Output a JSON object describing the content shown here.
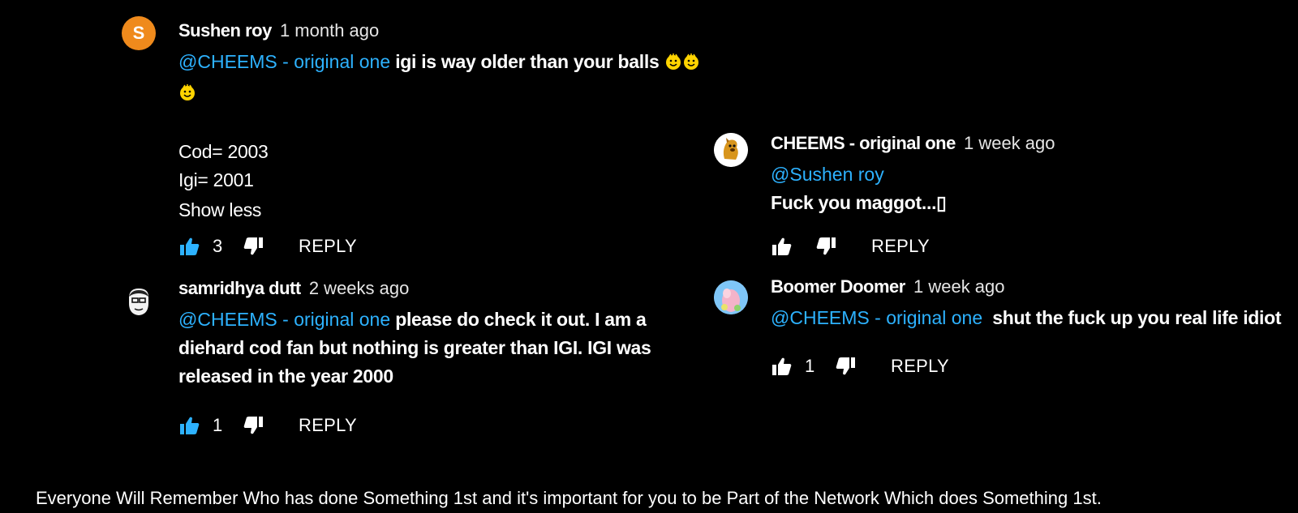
{
  "colors": {
    "mention": "#2db2ff",
    "liked": "#2db2ff",
    "avatar_s": "#ef8a1c"
  },
  "comments": [
    {
      "avatar_letter": "S",
      "author": "Sushen roy",
      "time": "1 month ago",
      "mention": "@CHEEMS - original one",
      "text_line1": " igi is way older than your balls",
      "lines": [
        "Cod= 2003",
        "Igi= 2001",
        "Show less"
      ],
      "likes": "3",
      "reply_label": "REPLY"
    },
    {
      "author": "samridhya dutt",
      "time": "2 weeks ago",
      "mention": "@CHEEMS - original one",
      "text_line1": " please do check it out. I am a",
      "text_line2": "diehard cod fan but nothing is greater than IGI. IGI was",
      "text_line3": "released in the year 2000",
      "likes": "1",
      "reply_label": "REPLY"
    },
    {
      "author": "CHEEMS - original one",
      "time": "1 week ago",
      "mention": "@Sushen roy",
      "text_line2": "Fuck you maggot...▯",
      "reply_label": "REPLY"
    },
    {
      "author": "Boomer Doomer",
      "time": "1 week ago",
      "mention": "@CHEEMS - original one",
      "text_line1": "  shut the fuck up you real life idiot",
      "likes": "1",
      "reply_label": "REPLY"
    }
  ],
  "footer_text": "Everyone Will Remember Who has done Something 1st and it's important for you to be Part of the Network Which does Something 1st.",
  "icons": [
    "thumbs-up-icon",
    "thumbs-down-icon",
    "emoji-icon"
  ]
}
